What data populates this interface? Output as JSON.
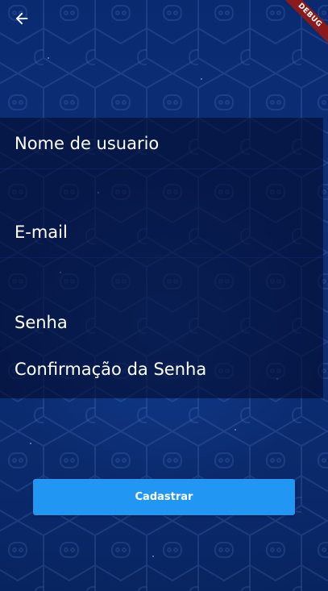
{
  "header": {
    "back_icon": "arrow-back-icon",
    "debug_banner": "DEBUG"
  },
  "form": {
    "fields": [
      {
        "label": "Nome de usuario"
      },
      {
        "label": "E-mail"
      },
      {
        "label": "Senha"
      },
      {
        "label": "Confirmação da Senha"
      }
    ]
  },
  "actions": {
    "submit_label": "Cadastrar"
  },
  "colors": {
    "background": "#0b2a6a",
    "panel": "#040c2d",
    "button": "#2196f3",
    "debug_banner": "#8b1a1a",
    "text": "#ffffff"
  }
}
